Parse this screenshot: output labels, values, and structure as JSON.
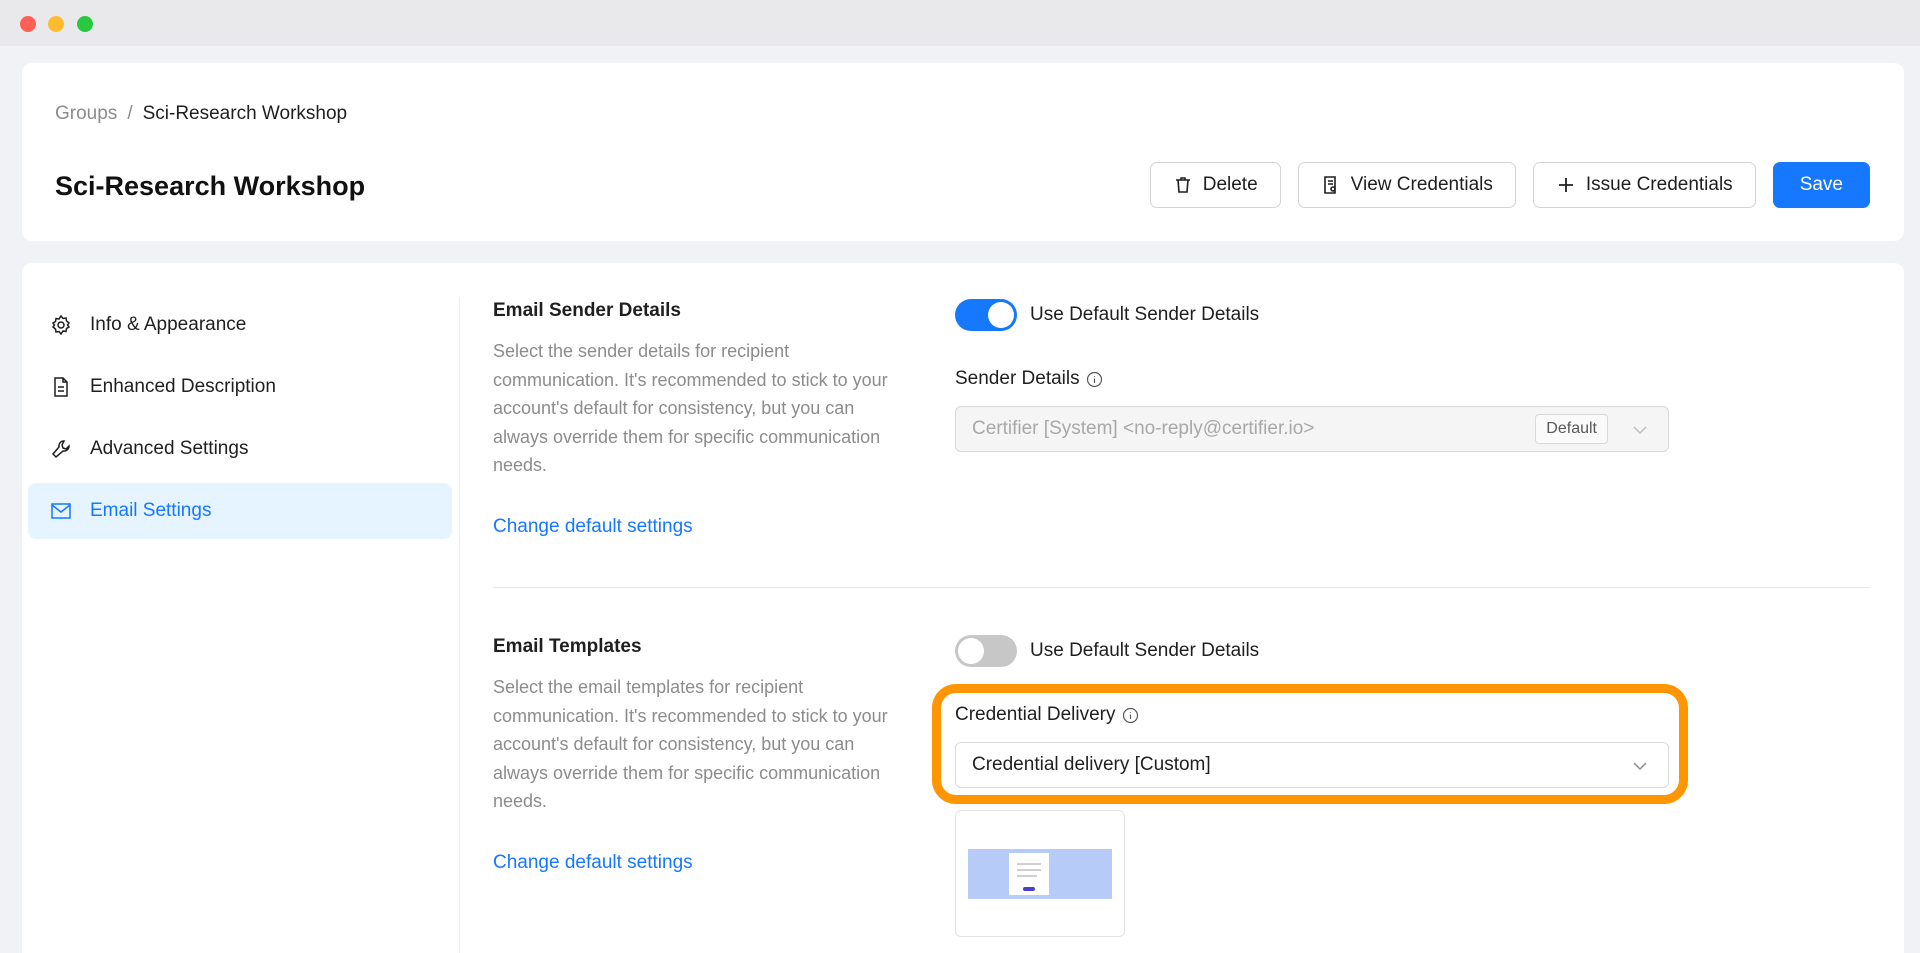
{
  "breadcrumb": {
    "parent": "Groups",
    "separator": "/",
    "current": "Sci-Research Workshop"
  },
  "page": {
    "title": "Sci-Research Workshop"
  },
  "actions": {
    "delete": "Delete",
    "view_credentials": "View Credentials",
    "issue_credentials": "Issue Credentials",
    "save": "Save"
  },
  "sidebar": {
    "items": [
      {
        "label": "Info & Appearance",
        "icon": "gear-icon"
      },
      {
        "label": "Enhanced Description",
        "icon": "document-icon"
      },
      {
        "label": "Advanced Settings",
        "icon": "wrench-icon"
      },
      {
        "label": "Email Settings",
        "icon": "mail-icon",
        "active": true
      }
    ]
  },
  "sender_section": {
    "title": "Email Sender Details",
    "description": "Select the sender details for recipient communication. It's recommended to stick to your account's default for consistency, but you can always override them for specific communication needs.",
    "link": "Change default settings",
    "toggle_label": "Use Default Sender Details",
    "toggle_on": true,
    "field_label": "Sender Details",
    "field_value": "Certifier [System] <no-reply@certifier.io>",
    "badge": "Default"
  },
  "templates_section": {
    "title": "Email Templates",
    "description": "Select the email templates for recipient communication. It's recommended to stick to your account's default for consistency, but you can always override them for specific communication needs.",
    "link": "Change default settings",
    "toggle_label": "Use Default Sender Details",
    "toggle_on": false,
    "field_label": "Credential Delivery",
    "field_value": "Credential delivery [Custom]"
  },
  "colors": {
    "accent": "#1677ff",
    "highlight": "#ff9500",
    "active_bg": "#e6f4ff"
  }
}
